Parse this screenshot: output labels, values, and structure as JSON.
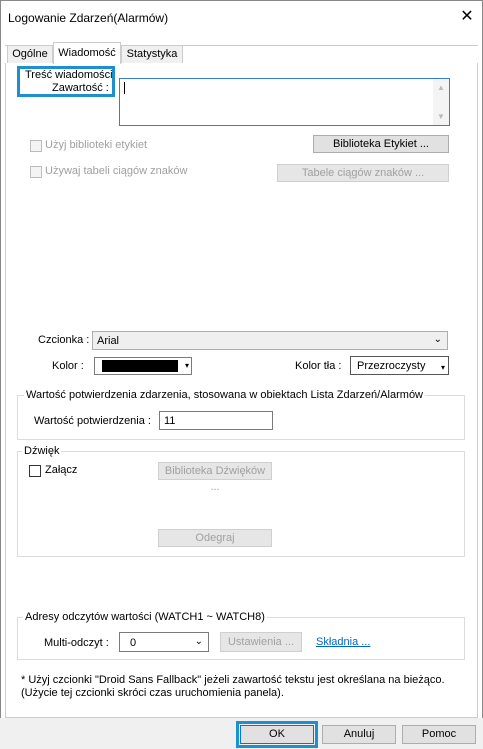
{
  "window": {
    "title": "Logowanie Zdarzeń(Alarmów)",
    "close_symbol": "✕"
  },
  "tabs": [
    {
      "label": "Ogólne"
    },
    {
      "label": "Wiadomość"
    },
    {
      "label": "Statystyka"
    }
  ],
  "message": {
    "section_label": "Treść wiadomości",
    "content_label": "Zawartość :",
    "content_value": "",
    "use_label_library": "Użyj biblioteki etykiet",
    "label_library_button": "Biblioteka Etykiet ...",
    "use_string_table": "Używaj tabeli ciągów znaków",
    "string_table_button": "Tabele ciągów znaków ...",
    "font_label": "Czcionka :",
    "font_value": "Arial",
    "color_label": "Kolor :",
    "color_value": "#000000",
    "bg_color_label": "Kolor tła :",
    "bg_color_value": "Przezroczysty"
  },
  "ack": {
    "group_label": "Wartość potwierdzenia zdarzenia, stosowana w obiektach Lista Zdarzeń/Alarmów",
    "value_label": "Wartość potwierdzenia :",
    "value": "11"
  },
  "sound": {
    "group_label": "Dźwięk",
    "enable_label": "Załącz",
    "library_button": "Biblioteka Dźwięków ...",
    "play_button": "Odegraj"
  },
  "watch": {
    "group_label": "Adresy odczytów wartości (WATCH1 ~ WATCH8)",
    "multi_read_label": "Multi-odczyt :",
    "multi_read_value": "0",
    "settings_button": "Ustawienia ...",
    "syntax_link": "Składnia ..."
  },
  "note": {
    "line1": "* Użyj czcionki \"Droid Sans Fallback\" jeżeli zawartość tekstu jest określana na bieżąco.",
    "line2": "(Użycie tej czcionki skróci czas uruchomienia panela)."
  },
  "footer": {
    "ok": "OK",
    "cancel": "Anuluj",
    "help": "Pomoc"
  }
}
